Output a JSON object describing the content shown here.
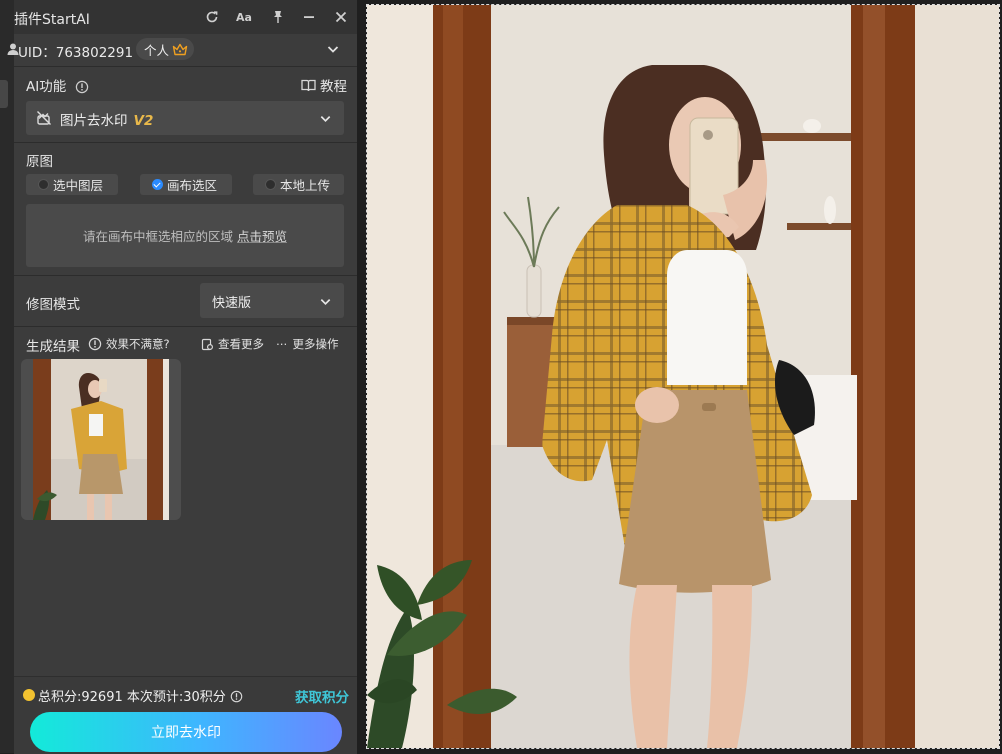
{
  "titlebar": {
    "title": "插件StartAI",
    "icons": [
      "refresh-icon",
      "font-size-icon",
      "pin-icon",
      "minimize-icon",
      "close-icon"
    ],
    "font_label": "Aa"
  },
  "account": {
    "uid": "UID：763802291",
    "badge": "个人",
    "badge_icon": "crown-icon"
  },
  "ai_feature": {
    "label": "AI功能",
    "tutorial": "教程",
    "selected_name": "图片去水印",
    "selected_version": "V2"
  },
  "source": {
    "label": "原图",
    "options": [
      {
        "label": "选中图层",
        "checked": false
      },
      {
        "label": "画布选区",
        "checked": true
      },
      {
        "label": "本地上传",
        "checked": false
      }
    ],
    "hint": "请在画布中框选相应的区域",
    "preview_link": "点击预览"
  },
  "mode": {
    "label": "修图模式",
    "value": "快速版"
  },
  "results": {
    "label": "生成结果",
    "feedback": "效果不满意?",
    "view_more": "查看更多",
    "more_actions": "更多操作"
  },
  "footer": {
    "points_text": "总积分:92691  本次预计:30积分",
    "get_points": "获取积分",
    "action_button": "立即去水印"
  },
  "colors": {
    "accent_link": "#3fc7d8",
    "version_badge": "#e8b84a",
    "button_gradient_start": "#13ead9",
    "button_gradient_end": "#6a86ff",
    "radio_checked": "#2b8bff"
  }
}
